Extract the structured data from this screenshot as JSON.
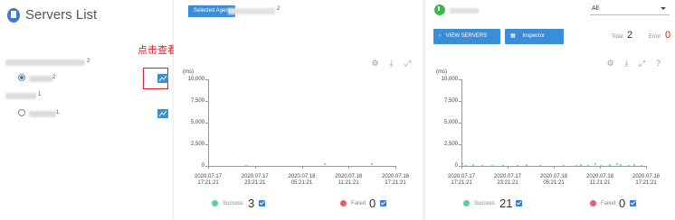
{
  "left": {
    "title": "Servers List",
    "annotation": "点击查看更详细的信息",
    "agents": [
      {
        "suffix": "2",
        "sub_suffix": "2",
        "selected": true
      },
      {
        "suffix": "1",
        "sub_suffix": "1",
        "selected": false
      }
    ]
  },
  "mid": {
    "selected_agent_label": "Selected Agent",
    "selected_agent_suffix": "2",
    "chart_data": {
      "type": "scatter",
      "ylabel": "(ms)",
      "ylim": [
        0,
        10000
      ],
      "yticks": [
        "10,000",
        "7,500",
        "5,000",
        "2,500",
        "0"
      ],
      "xticks": [
        [
          "2020.07.17",
          "17:21:21"
        ],
        [
          "2020.07.17",
          "23:21:21"
        ],
        [
          "2020.07.18",
          "05:21:21"
        ],
        [
          "2020.07.18",
          "11:21:21"
        ],
        [
          "2020.07.18",
          "17:21:21"
        ]
      ],
      "legend": {
        "success_label": "Success",
        "success_count": "3",
        "failed_label": "Failed",
        "failed_count": "0"
      }
    }
  },
  "right": {
    "filter_value": "All",
    "view_servers_label": "VIEW SERVERS",
    "inspector_label": "Inspector",
    "total_label": "Total",
    "total_value": "2",
    "error_label": "Error",
    "error_value": "0",
    "chart_data": {
      "type": "scatter",
      "ylabel": "(ms)",
      "ylim": [
        0,
        10000
      ],
      "yticks": [
        "10,000",
        "7,500",
        "5,000",
        "2,500",
        "0"
      ],
      "xticks": [
        [
          "2020.07.17",
          "17:21:21"
        ],
        [
          "2020.07.17",
          "23:21:21"
        ],
        [
          "2020.07.18",
          "05:21:21"
        ],
        [
          "2020.07.18",
          "11:21:21"
        ],
        [
          "2020.07.18",
          "17:21:21"
        ]
      ],
      "legend": {
        "success_label": "Success",
        "success_count": "21",
        "failed_label": "Failed",
        "failed_count": "0"
      }
    }
  },
  "colors": {
    "accent": "#3a8ed9",
    "success": "#5ccfa1",
    "failed": "#e85d6c",
    "error": "#e02020"
  },
  "icons": [
    "gear-icon",
    "download-icon",
    "fullscreen-icon",
    "help-icon",
    "chart-icon",
    "power-icon",
    "file-icon"
  ]
}
